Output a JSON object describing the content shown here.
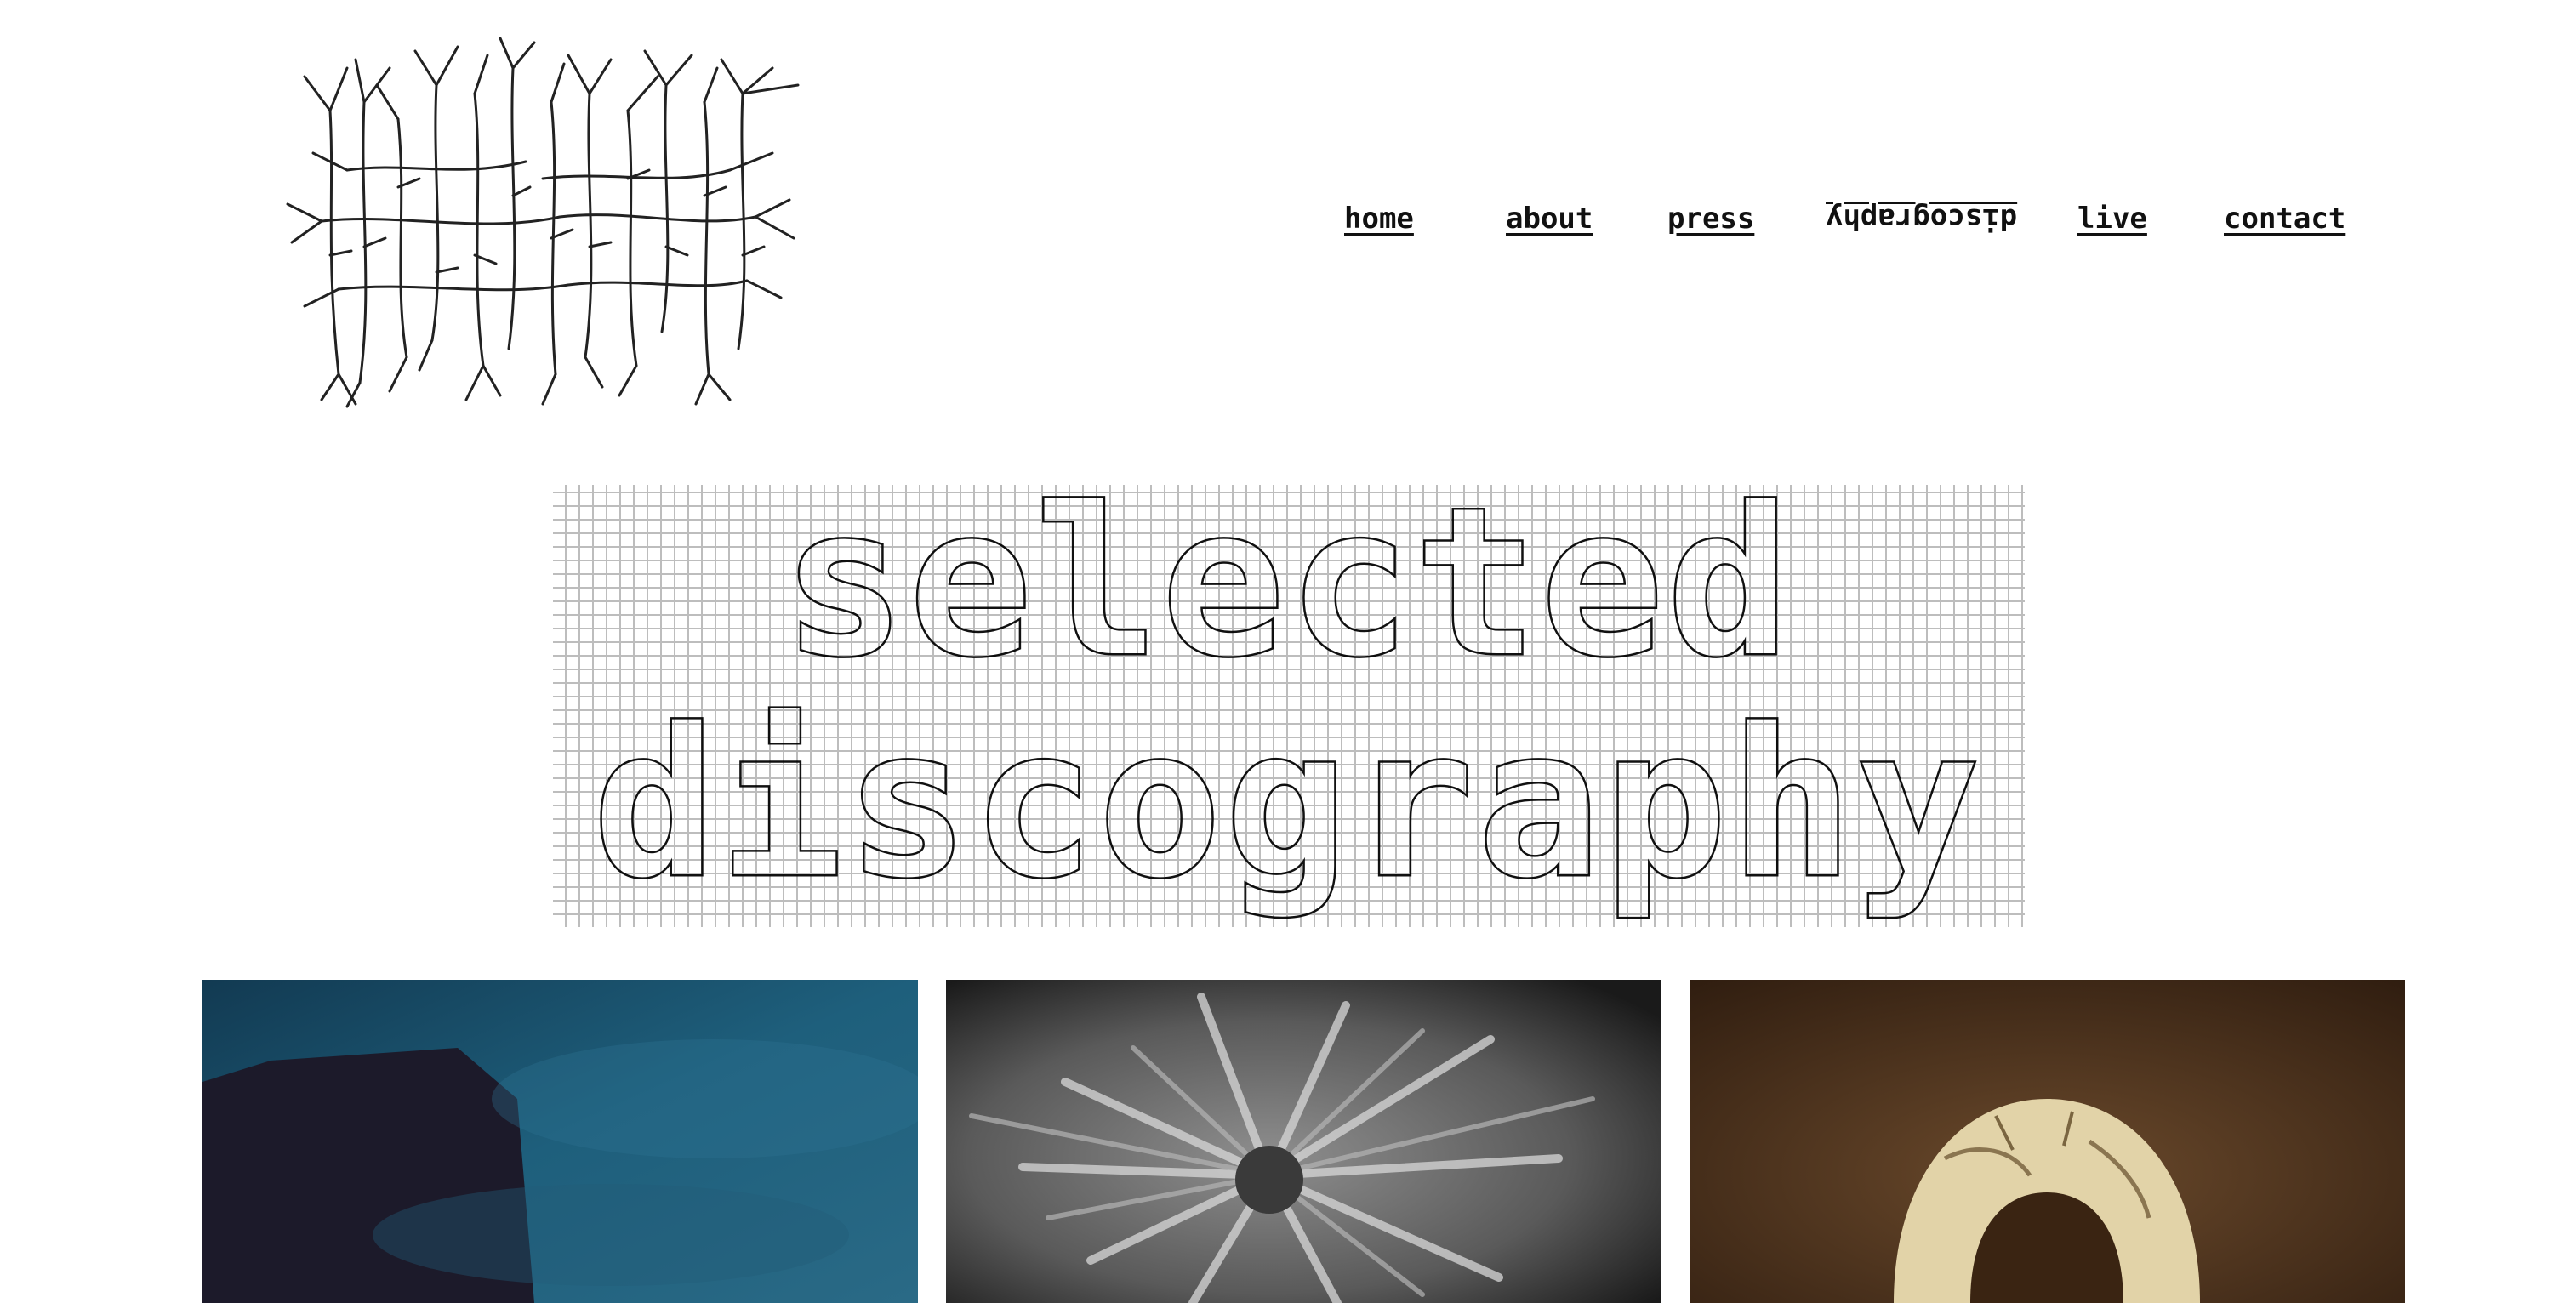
{
  "logo": {
    "icon": "branching-tree-logo"
  },
  "nav": {
    "items": [
      {
        "label": "home"
      },
      {
        "label": "about"
      },
      {
        "label": "press"
      },
      {
        "label": "discography"
      },
      {
        "label": "live"
      },
      {
        "label": "contact"
      }
    ]
  },
  "heading": {
    "line1": "selected",
    "line2": "discography"
  },
  "albums": [
    {
      "icon": "album-cover-blue-shadow"
    },
    {
      "icon": "album-cover-gray-flower"
    },
    {
      "icon": "album-cover-sepia-skull"
    }
  ],
  "colors": {
    "text": "#111111",
    "background": "#ffffff"
  }
}
